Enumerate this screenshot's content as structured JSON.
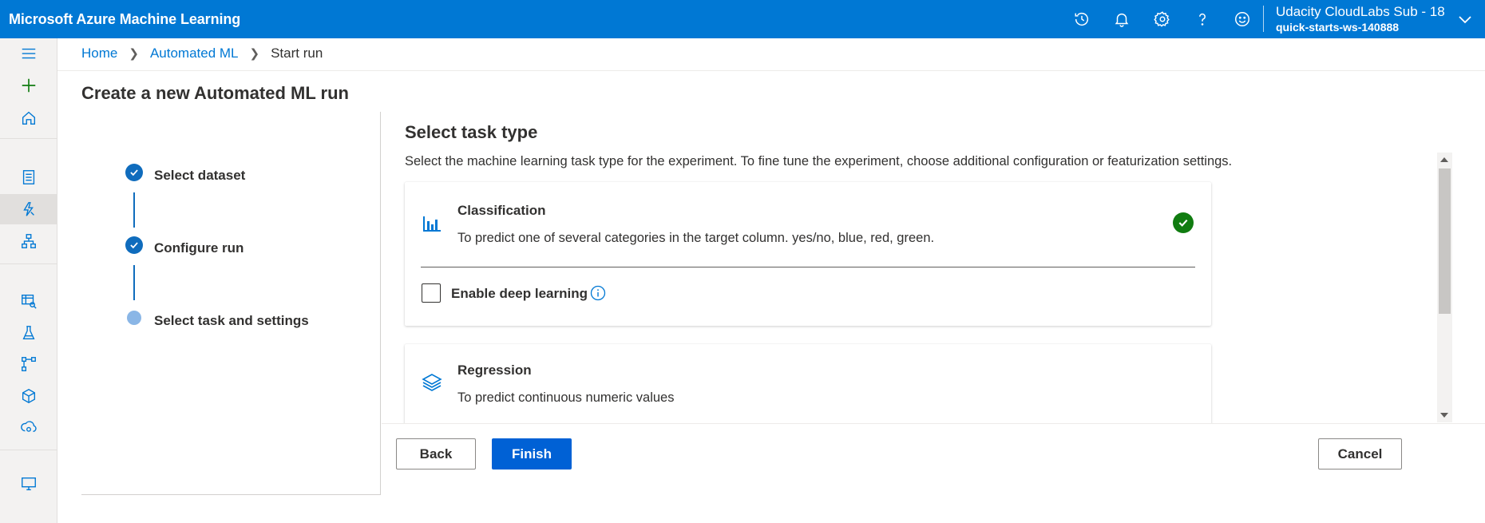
{
  "app": {
    "title": "Microsoft Azure Machine Learning",
    "brand_color": "#0078d4",
    "account": {
      "subscription": "Udacity CloudLabs Sub - 18",
      "workspace": "quick-starts-ws-140888"
    },
    "top_icons": [
      "history-icon",
      "bell-icon",
      "gear-icon",
      "help-icon",
      "feedback-smiley-icon",
      "chevron-down-icon"
    ]
  },
  "rail": {
    "items": [
      "hamburger-icon",
      "add-icon",
      "home-icon",
      "notebooks-icon",
      "automated-ml-icon",
      "designer-icon",
      "datasets-icon",
      "experiments-icon",
      "pipelines-icon",
      "models-icon",
      "endpoints-icon",
      "compute-icon"
    ]
  },
  "breadcrumb": {
    "home": "Home",
    "automl": "Automated ML",
    "current": "Start run"
  },
  "page_title": "Create a new Automated ML run",
  "steps": [
    {
      "label": "Select dataset",
      "state": "done"
    },
    {
      "label": "Configure run",
      "state": "done"
    },
    {
      "label": "Select task and settings",
      "state": "current"
    }
  ],
  "main": {
    "title": "Select task type",
    "description": "Select the machine learning task type for the experiment. To fine tune the experiment, choose additional configuration or featurization settings.",
    "tasks": [
      {
        "title": "Classification",
        "description": "To predict one of several categories in the target column. yes/no, blue, red, green.",
        "selected": true,
        "option_label": "Enable deep learning",
        "option_checked": false
      },
      {
        "title": "Regression",
        "description": "To predict continuous numeric values",
        "selected": false
      }
    ]
  },
  "buttons": {
    "back": "Back",
    "finish": "Finish",
    "cancel": "Cancel"
  },
  "colors": {
    "primary": "#0061d5",
    "success": "#107c10",
    "step": "#0f6cbd"
  }
}
